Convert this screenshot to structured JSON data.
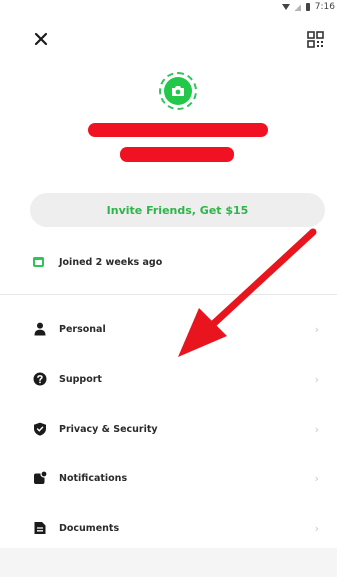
{
  "status_bar": {
    "time": "7:16"
  },
  "profile": {
    "invite_label": "Invite Friends, Get $15",
    "joined_text": "Joined 2 weeks ago"
  },
  "menu": {
    "items": [
      {
        "label": "Personal",
        "icon": "person-icon"
      },
      {
        "label": "Support",
        "icon": "help-icon"
      },
      {
        "label": "Privacy & Security",
        "icon": "shield-icon"
      },
      {
        "label": "Notifications",
        "icon": "notification-icon"
      },
      {
        "label": "Documents",
        "icon": "document-icon"
      }
    ],
    "chevron": "›"
  },
  "colors": {
    "accent_green": "#22c84a",
    "redaction_red": "#f01222",
    "annotation_red": "#e8151e"
  }
}
